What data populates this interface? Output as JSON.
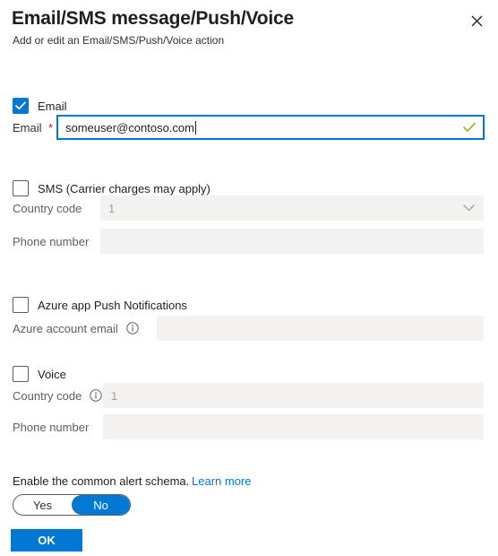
{
  "header": {
    "title": "Email/SMS message/Push/Voice",
    "subtitle": "Add or edit an Email/SMS/Push/Voice action",
    "close_icon": "close-icon"
  },
  "email_section": {
    "checkbox_label": "Email",
    "checked": true,
    "field_label": "Email",
    "required_marker": "*",
    "value": "someuser@contoso.com",
    "valid_icon": "check-icon"
  },
  "sms_section": {
    "checkbox_label": "SMS (Carrier charges may apply)",
    "checked": false,
    "country_code_label": "Country code",
    "country_code_value": "1",
    "country_code_icon": "chevron-down-icon",
    "phone_label": "Phone number",
    "phone_value": ""
  },
  "push_section": {
    "checkbox_label": "Azure app Push Notifications",
    "checked": false,
    "account_email_label": "Azure account email",
    "account_email_info_icon": "info-icon",
    "account_email_value": ""
  },
  "voice_section": {
    "checkbox_label": "Voice",
    "checked": false,
    "country_code_label": "Country code",
    "country_code_info_icon": "info-icon",
    "country_code_value": "1",
    "phone_label": "Phone number",
    "phone_value": ""
  },
  "footer": {
    "schema_label": "Enable the common alert schema.",
    "learn_more_label": "Learn more",
    "toggle_yes": "Yes",
    "toggle_no": "No",
    "toggle_selected": "No",
    "ok_label": "OK"
  },
  "colors": {
    "accent": "#0078d4",
    "required": "#a4262c",
    "valid_green": "#8cbd18",
    "field_disabled_bg": "#f3f2f1",
    "text_primary": "#201f1e",
    "text_secondary": "#605e5c",
    "text_placeholder": "#a19f9d"
  }
}
